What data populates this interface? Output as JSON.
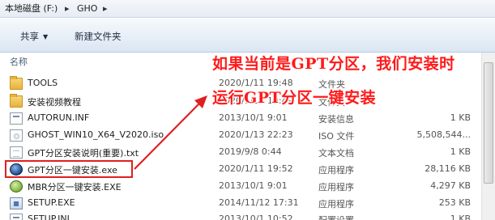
{
  "address": {
    "drive_label": "本地磁盘 (F:)",
    "separator1": "▸",
    "folder": "GHO",
    "separator2": "▸"
  },
  "toolbar": {
    "share_label": "共享",
    "share_caret": "▼",
    "new_folder_label": "新建文件夹"
  },
  "columns": {
    "name_label": "名称"
  },
  "files": [
    {
      "name": "TOOLS",
      "date": "2020/1/11 19:48",
      "type": "文件夹",
      "size": "",
      "icon": "folder-icon"
    },
    {
      "name": "安装视频教程",
      "date": "2020/1/11 19:49",
      "type": "文件夹",
      "size": "",
      "icon": "folder-icon"
    },
    {
      "name": "AUTORUN.INF",
      "date": "2013/10/1 9:01",
      "type": "安装信息",
      "size": "1 KB",
      "icon": "ini-icon"
    },
    {
      "name": "GHOST_WIN10_X64_V2020.iso",
      "date": "2020/1/13 22:23",
      "type": "ISO 文件",
      "size": "5,508,544...",
      "icon": "iso-icon"
    },
    {
      "name": "GPT分区安装说明(重要).txt",
      "date": "2019/9/8 0:44",
      "type": "文本文档",
      "size": "1 KB",
      "icon": "file-icon"
    },
    {
      "name": "GPT分区一键安装.exe",
      "date": "2020/1/11 19:52",
      "type": "应用程序",
      "size": "28,116 KB",
      "icon": "gpt-icon"
    },
    {
      "name": "MBR分区一键安装.EXE",
      "date": "2013/10/1 9:01",
      "type": "应用程序",
      "size": "4,297 KB",
      "icon": "mbr-icon"
    },
    {
      "name": "SETUP.EXE",
      "date": "2014/11/12 17:31",
      "type": "应用程序",
      "size": "253 KB",
      "icon": "setup-icon"
    },
    {
      "name": "SETUP.INI",
      "date": "2013/10/1 10:52",
      "type": "配置设置",
      "size": "1 KB",
      "icon": "ini-icon"
    }
  ],
  "annotation": {
    "line1": "如果当前是GPT分区，我们安装时",
    "line2": "运行GPT分区一键安装",
    "color": "#ff1a1a"
  }
}
